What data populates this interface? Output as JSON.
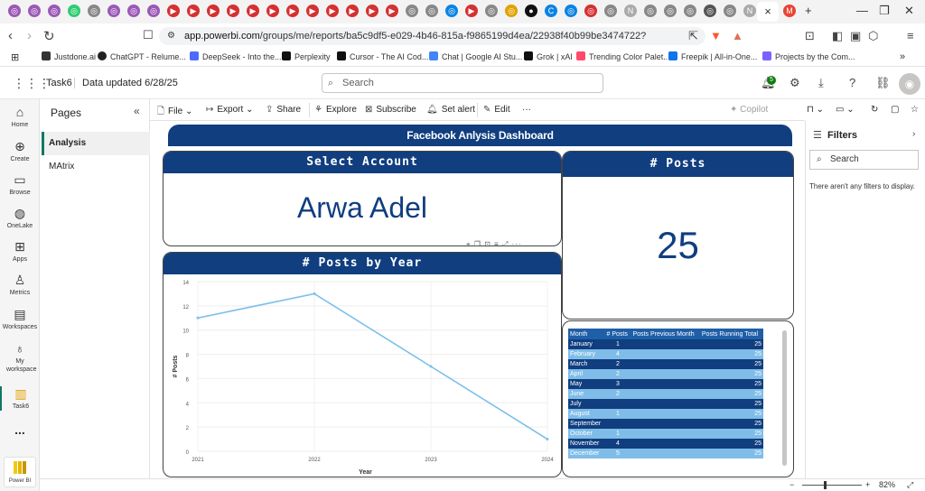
{
  "browser": {
    "url_domain": "app.powerbi.com",
    "url_path": "/groups/me/reports/ba5c9df5-e029-4b46-815a-f9865199d4ea/22938f40b99be3474722?experience=power-bi",
    "active_tab_close": "×",
    "new_tab": "+",
    "brave_badge": "1",
    "alert_badge": "1"
  },
  "bookmarks": [
    {
      "label": "Justdone.ai",
      "color": "#333333"
    },
    {
      "label": "ChatGPT - Relume...",
      "color": "#222222"
    },
    {
      "label": "DeepSeek - Into the...",
      "color": "#4d6bfe"
    },
    {
      "label": "Perplexity",
      "color": "#111111"
    },
    {
      "label": "Cursor - The AI Cod...",
      "color": "#111111"
    },
    {
      "label": "Chat | Google AI Stu...",
      "color": "#4285f4"
    },
    {
      "label": "Grok | xAI",
      "color": "#111111"
    },
    {
      "label": "Trending Color Palet...",
      "color": "#ff4a6e"
    },
    {
      "label": "Freepik | All-in-One...",
      "color": "#1273eb"
    },
    {
      "label": "Projects by the Com...",
      "color": "#7b61ff"
    }
  ],
  "header": {
    "workspace": "Task6",
    "data_updated": "Data updated 6/28/25",
    "search_placeholder": "Search",
    "notification_count": "5"
  },
  "leftnav": [
    {
      "label": "Home",
      "icon": "home-icon"
    },
    {
      "label": "Create",
      "icon": "create-icon"
    },
    {
      "label": "Browse",
      "icon": "browse-icon"
    },
    {
      "label": "OneLake",
      "icon": "onelake-icon"
    },
    {
      "label": "Apps",
      "icon": "apps-icon"
    },
    {
      "label": "Metrics",
      "icon": "metrics-icon"
    },
    {
      "label": "Workspaces",
      "icon": "workspaces-icon"
    },
    {
      "label": "My workspace",
      "icon": "my-workspace-icon"
    },
    {
      "label": "Task6",
      "icon": "report-icon"
    },
    {
      "label": "...",
      "icon": "more-icon"
    },
    {
      "label": "Power BI",
      "icon": "powerbi-icon"
    }
  ],
  "pages": {
    "title": "Pages",
    "items": [
      "Analysis",
      "MAtrix"
    ]
  },
  "toolbar": {
    "file": "File",
    "export": "Export",
    "share": "Share",
    "explore": "Explore",
    "subscribe": "Subscribe",
    "set_alert": "Set alert",
    "edit": "Edit",
    "more": "···",
    "copilot": "Copilot"
  },
  "dashboard": {
    "title": "Facebook Anlysis Dashboard",
    "select_account_title": "Select Account",
    "account_name": "Arwa Adel",
    "posts_card_title": "# Posts",
    "posts_value": "25",
    "visual_header_icons": "⌖ ❐ ⊡ ≡ ⤢ ···"
  },
  "chart_data": {
    "type": "line",
    "title": "# Posts by Year",
    "xlabel": "Year",
    "ylabel": "# Posts",
    "x": [
      2021,
      2022,
      2023,
      2024
    ],
    "values": [
      11,
      13,
      7,
      1
    ],
    "ylim": [
      0,
      14
    ],
    "yticks": [
      0,
      2,
      4,
      6,
      8,
      10,
      12,
      14
    ],
    "line_color": "#7cc0ea",
    "grid": true
  },
  "month_table": {
    "headers": [
      "Month",
      "# Posts",
      "Posts Previous Month",
      "Posts Running Total"
    ],
    "rows": [
      {
        "month": "January",
        "posts": "1",
        "prev": "",
        "total": "25"
      },
      {
        "month": "February",
        "posts": "4",
        "prev": "",
        "total": "25"
      },
      {
        "month": "March",
        "posts": "2",
        "prev": "",
        "total": "25"
      },
      {
        "month": "April",
        "posts": "2",
        "prev": "",
        "total": "25"
      },
      {
        "month": "May",
        "posts": "3",
        "prev": "",
        "total": "25"
      },
      {
        "month": "June",
        "posts": "2",
        "prev": "",
        "total": "25"
      },
      {
        "month": "July",
        "posts": "",
        "prev": "",
        "total": "25"
      },
      {
        "month": "August",
        "posts": "1",
        "prev": "",
        "total": "25"
      },
      {
        "month": "September",
        "posts": "",
        "prev": "",
        "total": "25"
      },
      {
        "month": "October",
        "posts": "1",
        "prev": "",
        "total": "25"
      },
      {
        "month": "November",
        "posts": "4",
        "prev": "",
        "total": "25"
      },
      {
        "month": "December",
        "posts": "5",
        "prev": "",
        "total": "25"
      }
    ]
  },
  "filters": {
    "title": "Filters",
    "search_placeholder": "Search",
    "empty_message": "There aren't any filters to display."
  },
  "statusbar": {
    "zoom_minus": "−",
    "zoom_plus": "+",
    "zoom_level": "82%"
  },
  "colors": {
    "accent_navy": "#103e7f",
    "accent_light_blue": "#7fbde8",
    "pbi_green": "#117865"
  }
}
